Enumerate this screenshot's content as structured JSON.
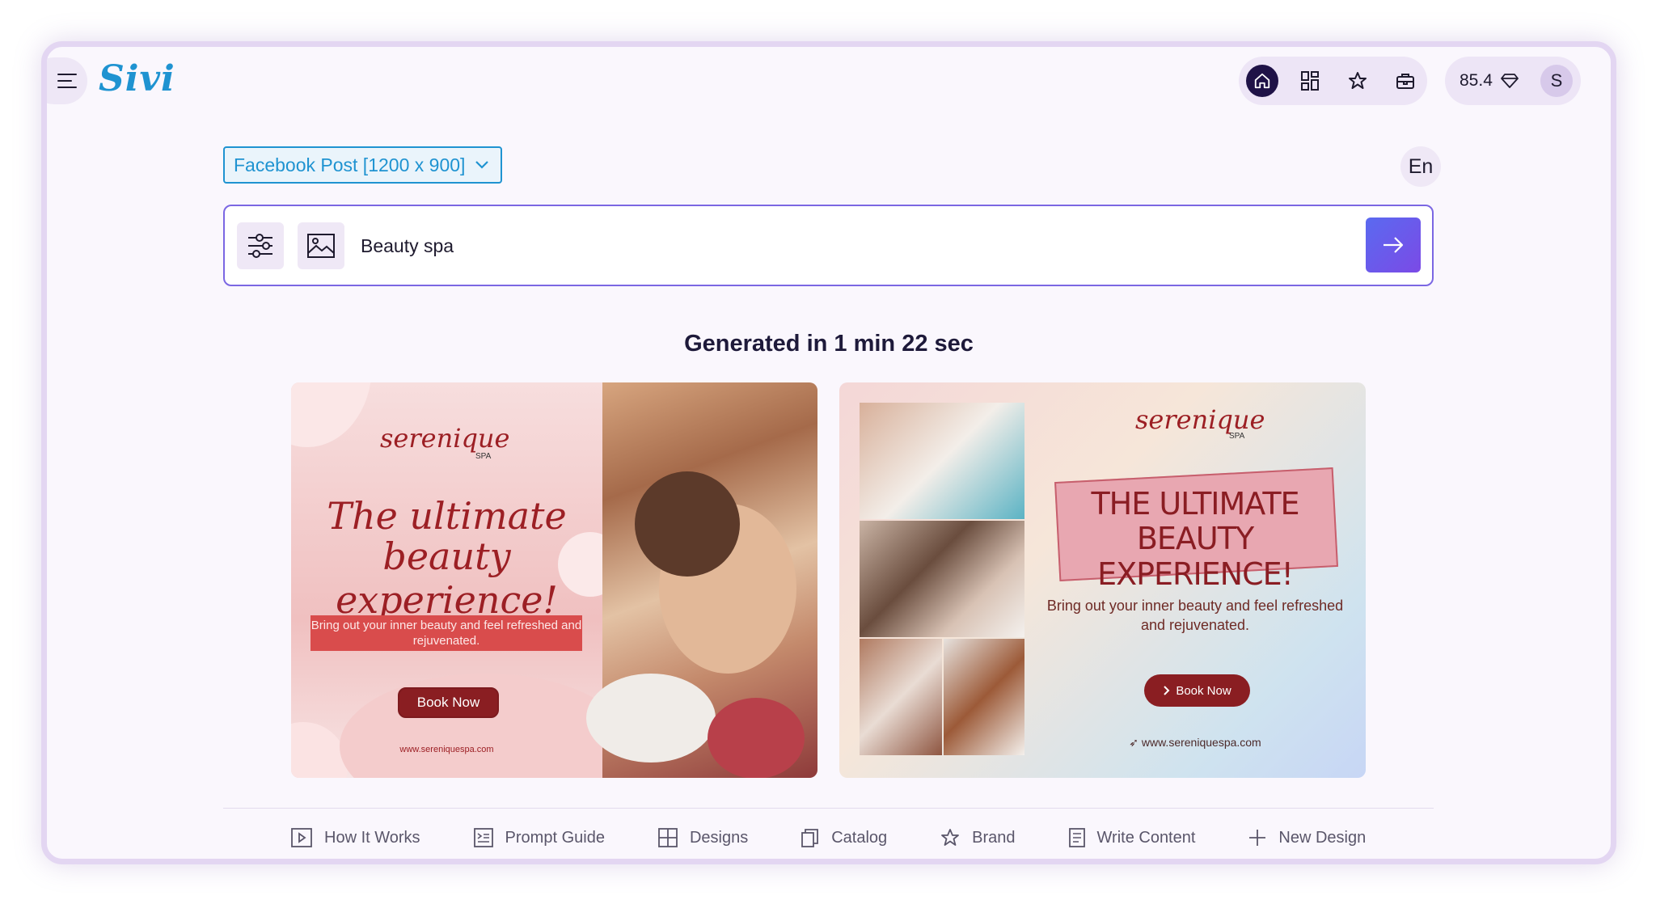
{
  "app": {
    "logo": "Sivi"
  },
  "header": {
    "nav_icons": [
      "home-icon",
      "templates-icon",
      "star-icon",
      "briefcase-icon"
    ],
    "credits": "85.4",
    "avatar_initial": "S"
  },
  "toolbar": {
    "size_select": "Facebook Post [1200 x 900]",
    "language": "En"
  },
  "prompt": {
    "value": "Beauty spa"
  },
  "results": {
    "title": "Generated in 1 min 22 sec",
    "cards": [
      {
        "brand": "serenique",
        "brand_sub": "SPA",
        "headline_line1": "The ultimate",
        "headline_line2": "beauty  experience!",
        "subtext": "Bring out your inner beauty and feel refreshed and rejuvenated.",
        "cta": "Book Now",
        "url": "www.sereniquespa.com"
      },
      {
        "brand": "serenique",
        "brand_sub": "SPA",
        "headline_line1": "THE ULTIMATE",
        "headline_line2": "BEAUTY EXPERIENCE!",
        "subtext": "Bring out your inner beauty and feel refreshed and rejuvenated.",
        "cta": "Book Now",
        "url": "www.sereniquespa.com"
      }
    ]
  },
  "bottom_nav": [
    {
      "label": "How It Works",
      "icon": "play-icon"
    },
    {
      "label": "Prompt Guide",
      "icon": "prompt-guide-icon"
    },
    {
      "label": "Designs",
      "icon": "grid-icon"
    },
    {
      "label": "Catalog",
      "icon": "catalog-icon"
    },
    {
      "label": "Brand",
      "icon": "star-icon"
    },
    {
      "label": "Write Content",
      "icon": "document-icon"
    },
    {
      "label": "New Design",
      "icon": "plus-icon"
    }
  ],
  "colors": {
    "accent": "#1f93d1",
    "primary_button": "#6a5ce8",
    "dark_nav": "#1f1247",
    "brand_red": "#9c1f24"
  }
}
